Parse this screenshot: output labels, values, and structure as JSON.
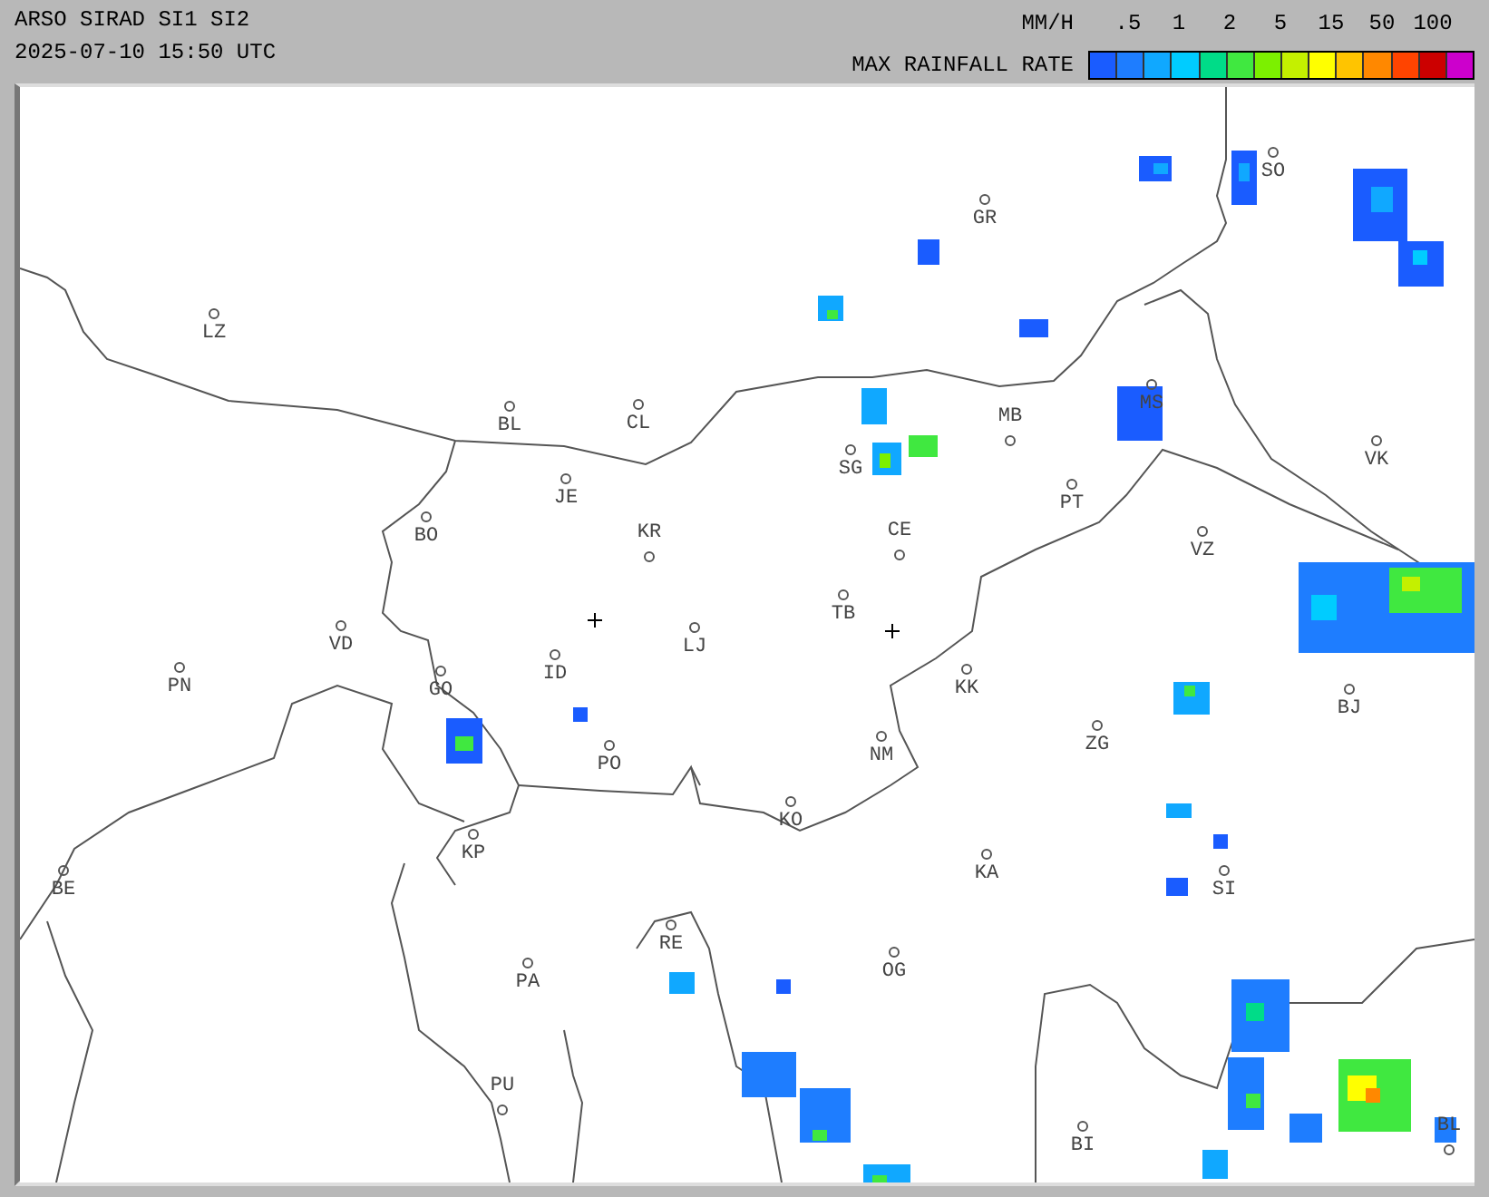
{
  "header": {
    "title": "ARSO SIRAD SI1 SI2",
    "timestamp": "2025-07-10 15:50 UTC"
  },
  "legend": {
    "unit": "MM/H",
    "caption": "MAX RAINFALL RATE",
    "ticks": [
      ".5",
      "1",
      "2",
      "5",
      "15",
      "50",
      "100"
    ],
    "swatches": [
      {
        "color": "#1a5cff"
      },
      {
        "color": "#1e7dff"
      },
      {
        "color": "#10a8ff"
      },
      {
        "color": "#00ccff"
      },
      {
        "color": "#00dc88"
      },
      {
        "color": "#40e840"
      },
      {
        "color": "#7cf000"
      },
      {
        "color": "#c4f000"
      },
      {
        "color": "#ffff00"
      },
      {
        "color": "#ffc400"
      },
      {
        "color": "#ff8800"
      },
      {
        "color": "#ff4400"
      },
      {
        "color": "#cc0000"
      },
      {
        "color": "#cc00cc"
      }
    ]
  },
  "cities": [
    {
      "label": "LZ"
    },
    {
      "label": "BL"
    },
    {
      "label": "CL"
    },
    {
      "label": "JE"
    },
    {
      "label": "BO"
    },
    {
      "label": "KR"
    },
    {
      "label": "GR"
    },
    {
      "label": "SO"
    },
    {
      "label": "MB"
    },
    {
      "label": "SG"
    },
    {
      "label": "MS"
    },
    {
      "label": "VK"
    },
    {
      "label": "PT"
    },
    {
      "label": "CE"
    },
    {
      "label": "VZ"
    },
    {
      "label": "TB"
    },
    {
      "label": "LJ"
    },
    {
      "label": "VD"
    },
    {
      "label": "PN"
    },
    {
      "label": "ID"
    },
    {
      "label": "GO"
    },
    {
      "label": "KK"
    },
    {
      "label": "BJ"
    },
    {
      "label": "NM"
    },
    {
      "label": "ZG"
    },
    {
      "label": "PO"
    },
    {
      "label": "KO"
    },
    {
      "label": "KP"
    },
    {
      "label": "KA"
    },
    {
      "label": "SI"
    },
    {
      "label": "BE"
    },
    {
      "label": "RE"
    },
    {
      "label": "OG"
    },
    {
      "label": "PA"
    },
    {
      "label": "PU"
    },
    {
      "label": "BI"
    },
    {
      "label": "BL"
    }
  ]
}
